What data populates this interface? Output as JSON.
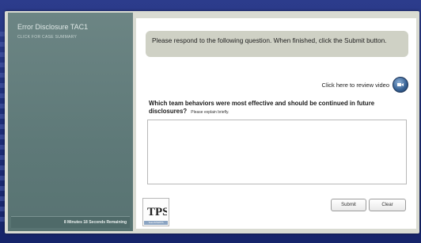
{
  "sidebar": {
    "title": "Error Disclosure TAC1",
    "case_summary_link": "CLICK FOR CASE SUMMARY",
    "timer": "8 Minutes 18 Seconds Remaining"
  },
  "main": {
    "prompt": "Please respond to the following question. When finished, click the Submit button.",
    "review_video_label": "Click here to review video",
    "question": "Which team behaviors were most effective and should be continued in future disclosures?",
    "question_hint": "Please explain briefly.",
    "answer_value": "",
    "submit_label": "Submit",
    "clear_label": "Clear"
  },
  "logo": {
    "mark": "TPS",
    "caption": "TeamSTEPPS"
  },
  "colors": {
    "background": "#1e2d78",
    "sidebar": "#5e7978",
    "prompt_box": "#cfd1c5",
    "video_icon": "#345f92"
  },
  "icons": {
    "review": "video-play-icon"
  }
}
